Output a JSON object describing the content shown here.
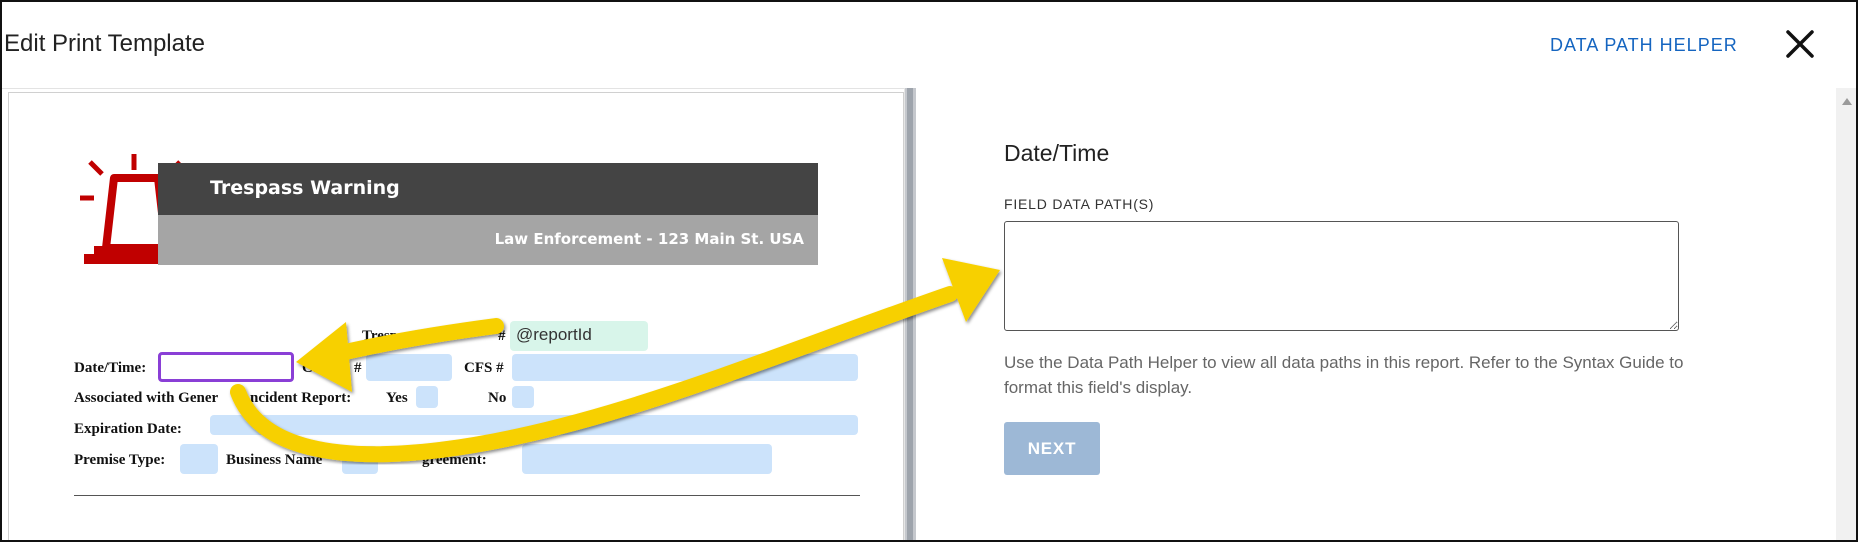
{
  "header": {
    "title": "Edit Print Template",
    "data_path_helper_label": "DATA PATH HELPER",
    "close_icon": "close-icon"
  },
  "document": {
    "siren_icon": "siren-icon",
    "banner_title": "Trespass Warning",
    "banner_subtitle": "Law Enforcement - 123 Main St. USA",
    "trespass_label": "Trespass W",
    "trespass_label_tail": "#",
    "report_id_tag": "@reportId",
    "datetime_label": "Date/Time:",
    "case_label": "Ca",
    "case_label_tail": "#",
    "cfs_label": "CFS #",
    "associated_label": "Associated with Gener",
    "associated_label_tail": "ncident Report:",
    "yes_label": "Yes",
    "no_label": "No",
    "expiration_label": "Expiration Date:",
    "premise_label": "Premise Type:",
    "business_label": "Business Name",
    "agreement_label": "greement:"
  },
  "form": {
    "title": "Date/Time",
    "field_label": "FIELD DATA PATH(S)",
    "field_value": "",
    "help_text": "Use the Data Path Helper to view all data paths in this report. Refer to the Syntax Guide to format this field's display.",
    "next_label": "NEXT"
  },
  "colors": {
    "accent_link": "#1565c0",
    "active_field_border": "#8a3fd6",
    "field_fill": "#cce3fb",
    "tag_fill": "#d8f5ea",
    "arrow": "#f7d000",
    "siren": "#c00000",
    "next_disabled": "#9db8d6"
  }
}
